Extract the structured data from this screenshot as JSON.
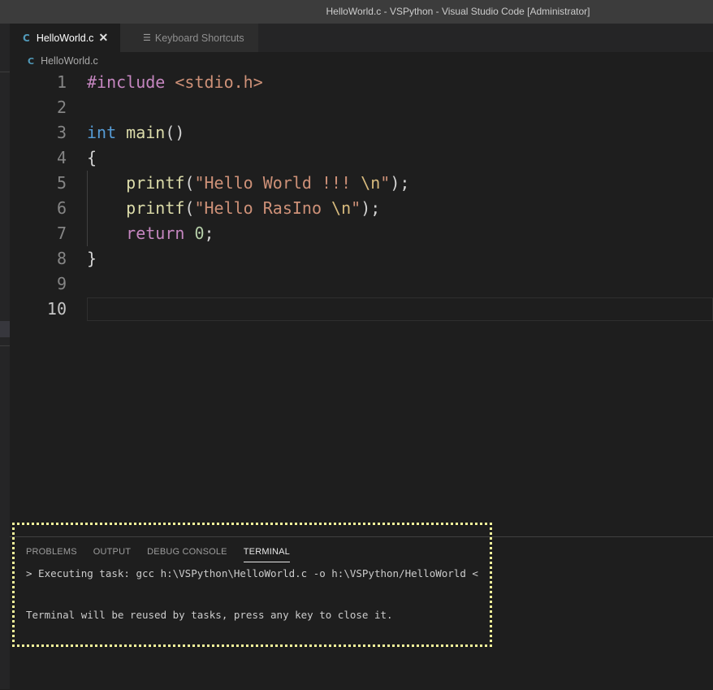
{
  "window": {
    "title": "HelloWorld.c - VSPython - Visual Studio Code [Administrator]"
  },
  "tabs": [
    {
      "icon": "C",
      "label": "HelloWorld.c",
      "close": "✕"
    },
    {
      "label": "Keyboard Shortcuts"
    }
  ],
  "breadcrumb": {
    "icon": "C",
    "file": "HelloWorld.c"
  },
  "editor": {
    "line_numbers": [
      "1",
      "2",
      "3",
      "4",
      "5",
      "6",
      "7",
      "8",
      "9",
      "10"
    ],
    "line1": {
      "directive": "#include",
      "header": "<stdio.h>"
    },
    "line3": {
      "type": "int",
      "name": "main",
      "parens": "()"
    },
    "line4": {
      "text": "{"
    },
    "line5": {
      "fn": "printf",
      "open": "(",
      "str1": "\"Hello World !!! ",
      "esc": "\\n",
      "str2": "\"",
      "close": ");"
    },
    "line6": {
      "fn": "printf",
      "open": "(",
      "str1": "\"Hello RasIno ",
      "esc": "\\n",
      "str2": "\"",
      "close": ");"
    },
    "line7": {
      "kw": "return",
      "num": "0",
      "end": ";"
    },
    "line8": {
      "text": "}"
    }
  },
  "panel": {
    "tabs": [
      "PROBLEMS",
      "OUTPUT",
      "DEBUG CONSOLE",
      "TERMINAL"
    ],
    "active_tab": "TERMINAL",
    "terminal_lines": [
      "> Executing task: gcc h:\\VSPython\\HelloWorld.c -o h:\\VSPython/HelloWorld <",
      "Terminal will be reused by tasks, press any key to close it."
    ]
  },
  "colors": {
    "highlight_border": "#f4f49a",
    "c_icon": "#519aba"
  }
}
